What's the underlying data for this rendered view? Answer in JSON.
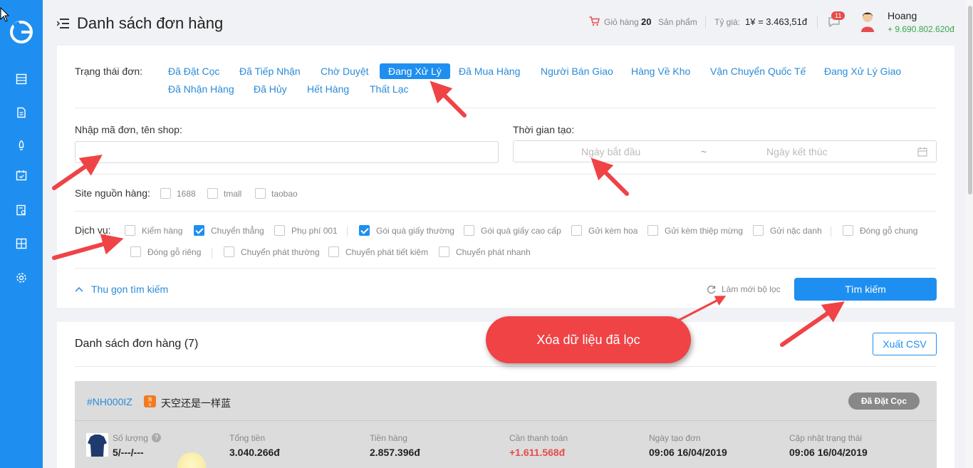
{
  "header": {
    "title": "Danh sách đơn hàng",
    "cart_label": "Giỏ hàng",
    "cart_count": "20",
    "cart_unit": "Sản phẩm",
    "rate_label": "Tỷ giá:",
    "rate_value": "1¥ = 3.463,51đ",
    "notif_count": "11",
    "user_name": "Hoang",
    "user_balance": "+ 9.690.802.620đ"
  },
  "sidebar": {
    "items": [
      "orders-icon",
      "document-icon",
      "rocket-icon",
      "calendar-icon",
      "report-icon",
      "calculator-icon",
      "gear-icon"
    ]
  },
  "filter": {
    "status_label": "Trạng thái đơn:",
    "statuses": [
      "Đã Đặt Cọc",
      "Đã Tiếp Nhận",
      "Chờ Duyệt",
      "Đang Xử Lý",
      "Đã Mua Hàng",
      "Người Bán Giao",
      "Hàng Về Kho",
      "Vận Chuyển Quốc Tế",
      "Đang Xử Lý Giao",
      "Đã Nhận Hàng",
      "Đã Hủy",
      "Hết Hàng",
      "Thất Lạc"
    ],
    "active_status": "Đang Xử Lý",
    "search_label": "Nhập mã đơn, tên shop:",
    "search_value": "",
    "time_label": "Thời gian tạo:",
    "start_placeholder": "Ngày bắt đầu",
    "range_sep": "~",
    "end_placeholder": "Ngày kết thúc",
    "site_label": "Site nguồn hàng:",
    "sites": [
      {
        "label": "1688",
        "checked": false
      },
      {
        "label": "tmall",
        "checked": false
      },
      {
        "label": "taobao",
        "checked": false
      }
    ],
    "service_label": "Dịch vụ:",
    "services": [
      {
        "label": "Kiểm hàng",
        "checked": false
      },
      {
        "label": "Chuyển thẳng",
        "checked": true
      },
      {
        "label": "Phụ phí 001",
        "checked": false
      },
      {
        "label": "Gói quà giấy thường",
        "checked": true
      },
      {
        "label": "Gói quà giấy cao cấp",
        "checked": false
      },
      {
        "label": "Gửi kèm hoa",
        "checked": false
      },
      {
        "label": "Gửi kèm thiệp mừng",
        "checked": false
      },
      {
        "label": "Gửi nặc danh",
        "checked": false
      },
      {
        "label": "Đóng gỗ chung",
        "checked": false
      },
      {
        "label": "Đóng gỗ riêng",
        "checked": false
      },
      {
        "label": "Chuyển phát thường",
        "checked": false
      },
      {
        "label": "Chuyển phát tiết kiệm",
        "checked": false
      },
      {
        "label": "Chuyển phát nhanh",
        "checked": false
      }
    ],
    "collapse_label": "Thu gọn tìm kiếm",
    "reset_label": "Làm mới bộ lọc",
    "search_button": "Tìm kiếm"
  },
  "list": {
    "title": "Danh sách đơn hàng (7)",
    "export_button": "Xuất CSV",
    "orders": [
      {
        "code": "#NH000IZ",
        "shop_name": "天空还是一样蓝",
        "status": "Đã Đặt Cọc",
        "qty_label": "Số lượng",
        "qty_value": "5/---/---",
        "total_label": "Tổng tiền",
        "total_value": "3.040.266đ",
        "goods_label": "Tiền hàng",
        "goods_value": "2.857.396đ",
        "due_label": "Cần thanh toán",
        "due_value": "+1.611.568đ",
        "created_label": "Ngày tạo đơn",
        "created_value": "09:06 16/04/2019",
        "updated_label": "Cập nhật trạng thái",
        "updated_value": "09:06 16/04/2019"
      }
    ]
  },
  "annotation": {
    "callout_text": "Xóa dữ liệu đã lọc"
  },
  "colors": {
    "primary": "#1e8ff0",
    "callout": "#ef4346",
    "balance": "#3aa54a",
    "due": "#e84b4b"
  }
}
